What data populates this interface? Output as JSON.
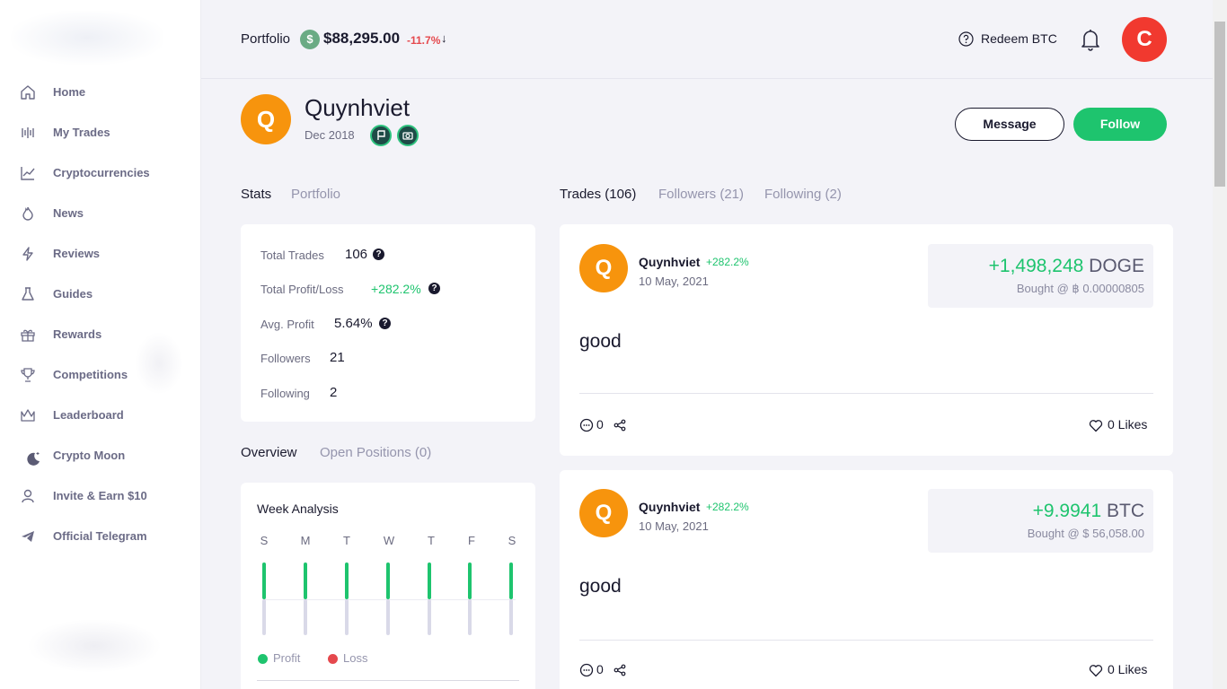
{
  "sidebar": {
    "items": [
      {
        "label": "Home",
        "icon": "home-icon"
      },
      {
        "label": "My Trades",
        "icon": "trades-icon"
      },
      {
        "label": "Cryptocurrencies",
        "icon": "chart-icon"
      },
      {
        "label": "News",
        "icon": "flame-icon"
      },
      {
        "label": "Reviews",
        "icon": "bolt-icon"
      },
      {
        "label": "Guides",
        "icon": "flask-icon"
      },
      {
        "label": "Rewards",
        "icon": "gift-icon"
      },
      {
        "label": "Competitions",
        "icon": "trophy-icon"
      },
      {
        "label": "Leaderboard",
        "icon": "crown-icon"
      },
      {
        "label": "Crypto Moon",
        "icon": "moon-icon"
      },
      {
        "label": "Invite & Earn $10",
        "icon": "user-icon"
      },
      {
        "label": "Official Telegram",
        "icon": "telegram-icon"
      }
    ]
  },
  "header": {
    "portfolio_label": "Portfolio",
    "portfolio_symbol": "$",
    "portfolio_value": "$88,295.00",
    "portfolio_change": "-11.7%",
    "portfolio_arrow": "↓",
    "redeem_label": "Redeem BTC",
    "avatar_initial": "C"
  },
  "profile": {
    "initial": "Q",
    "name": "Quynhviet",
    "joined": "Dec 2018",
    "message_label": "Message",
    "follow_label": "Follow"
  },
  "left_tabs": {
    "stats": "Stats",
    "portfolio": "Portfolio"
  },
  "stats": {
    "total_trades_label": "Total Trades",
    "total_trades": "106",
    "profit_loss_label": "Total Profit/Loss",
    "profit_loss": "+282.2%",
    "avg_profit_label": "Avg. Profit",
    "avg_profit": "5.64%",
    "followers_label": "Followers",
    "followers": "21",
    "following_label": "Following",
    "following": "2",
    "help_glyph": "?"
  },
  "overview_tabs": {
    "overview": "Overview",
    "open_positions": "Open Positions (0)"
  },
  "week_analysis": {
    "title": "Week Analysis",
    "days": [
      "S",
      "M",
      "T",
      "W",
      "T",
      "F",
      "S"
    ],
    "profit_label": "Profit",
    "loss_label": "Loss",
    "colors": {
      "profit": "#1ec46e",
      "loss": "#e5484d"
    }
  },
  "right_tabs": {
    "trades": "Trades (106)",
    "followers": "Followers (21)",
    "following": "Following (2)"
  },
  "trades": [
    {
      "initial": "Q",
      "user": "Quynhviet",
      "pct": "+282.2%",
      "date": "10 May, 2021",
      "amount": "+1,498,248",
      "currency": "DOGE",
      "bought": "Bought @ ฿ 0.00000805",
      "text": "good",
      "comments": "0",
      "likes": "0 Likes"
    },
    {
      "initial": "Q",
      "user": "Quynhviet",
      "pct": "+282.2%",
      "date": "10 May, 2021",
      "amount": "+9.9941",
      "currency": "BTC",
      "bought": "Bought @ $ 56,058.00",
      "text": "good",
      "comments": "0",
      "likes": "0 Likes"
    }
  ],
  "colors": {
    "accent_green": "#1ec46e",
    "negative_red": "#e5484d",
    "avatar_orange": "#f7940d",
    "user_avatar_red": "#f1392f"
  }
}
